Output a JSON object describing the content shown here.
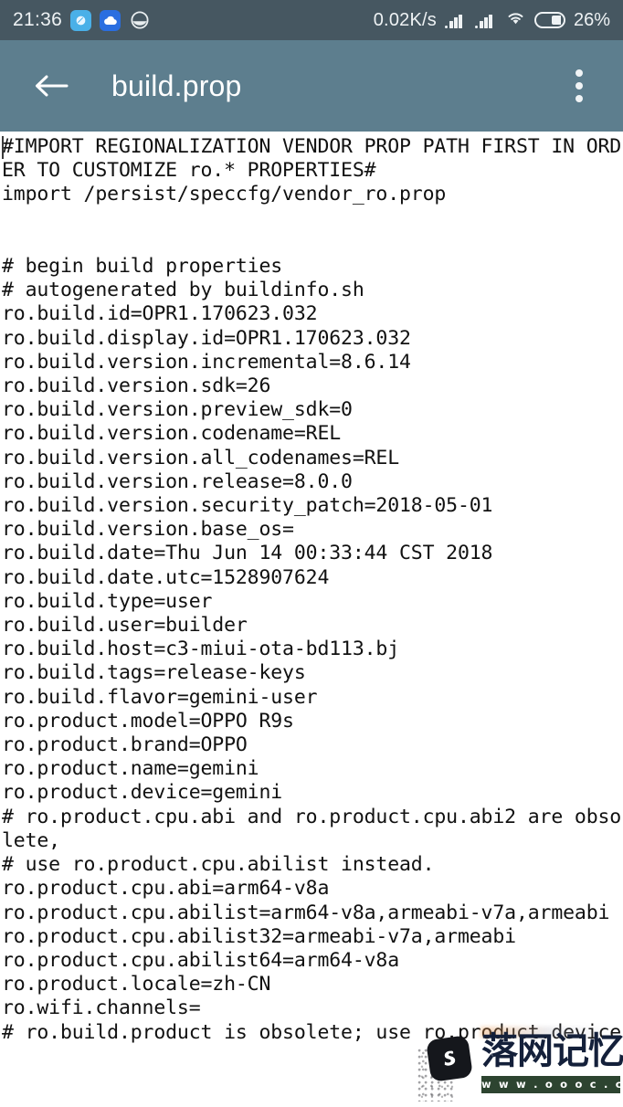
{
  "status_bar": {
    "clock": "21:36",
    "network_speed": "0.02K/s",
    "battery_percent": "26%",
    "icons": {
      "notification_bubble": "bubble-icon",
      "notification_cloud": "cloud-icon",
      "notification_face": "face-icon",
      "signal_one": "signal-bars-icon",
      "signal_two": "signal-bars-icon",
      "wifi": "wifi-icon",
      "battery": "battery-icon"
    },
    "background_color": "#465761"
  },
  "app_bar": {
    "back_icon": "back-arrow-icon",
    "title": "build.prop",
    "overflow_icon": "overflow-menu-icon",
    "background_color": "#5d7e8e",
    "title_color": "#ffffff"
  },
  "editor": {
    "background_color": "#ffffff",
    "text_color": "#111111",
    "caret_visible": true,
    "content": "#IMPORT REGIONALIZATION VENDOR PROP PATH FIRST IN ORDER TO CUSTOMIZE ro.* PROPERTIES#\nimport /persist/speccfg/vendor_ro.prop\n\n\n# begin build properties\n# autogenerated by buildinfo.sh\nro.build.id=OPR1.170623.032\nro.build.display.id=OPR1.170623.032\nro.build.version.incremental=8.6.14\nro.build.version.sdk=26\nro.build.version.preview_sdk=0\nro.build.version.codename=REL\nro.build.version.all_codenames=REL\nro.build.version.release=8.0.0\nro.build.version.security_patch=2018-05-01\nro.build.version.base_os=\nro.build.date=Thu Jun 14 00:33:44 CST 2018\nro.build.date.utc=1528907624\nro.build.type=user\nro.build.user=builder\nro.build.host=c3-miui-ota-bd113.bj\nro.build.tags=release-keys\nro.build.flavor=gemini-user\nro.product.model=OPPO R9s\nro.product.brand=OPPO\nro.product.name=gemini\nro.product.device=gemini\n# ro.product.cpu.abi and ro.product.cpu.abi2 are obsolete,\n# use ro.product.cpu.abilist instead.\nro.product.cpu.abi=arm64-v8a\nro.product.cpu.abilist=arm64-v8a,armeabi-v7a,armeabi\nro.product.cpu.abilist32=armeabi-v7a,armeabi\nro.product.cpu.abilist64=arm64-v8a\nro.product.locale=zh-CN\nro.wifi.channels=\n# ro.build.product is obsolete; use ro.product.device"
  },
  "watermark": {
    "brand_cn": "落网记忆",
    "url": "w w w . o o o c . c n",
    "logo_icon": "swan-app-logo-icon",
    "brand_color": "#14203a",
    "url_banner_color": "#2d4430"
  }
}
